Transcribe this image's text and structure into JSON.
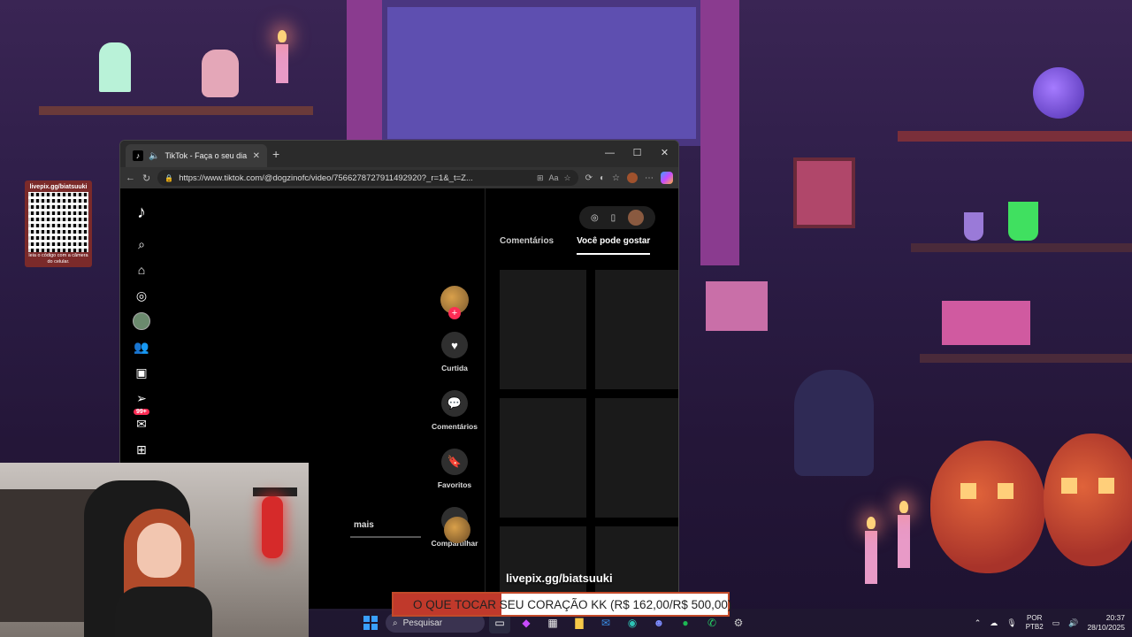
{
  "qr": {
    "top_text": "livepix.gg/biatsuuki",
    "bottom_text": "leia o código com a câmera do celular."
  },
  "browser": {
    "tab_title": "TikTok - Faça o seu dia",
    "new_tab_icon": "plus-icon",
    "url": "https://www.tiktok.com/@dogzinofc/video/7566278727911492920?_r=1&_t=Z...",
    "window_controls": [
      "minimize-icon",
      "maximize-icon",
      "close-icon"
    ]
  },
  "tiktok": {
    "actions": [
      {
        "icon": "heart-icon",
        "label": "Curtida"
      },
      {
        "icon": "comment-icon",
        "label": "Comentários"
      },
      {
        "icon": "bookmark-icon",
        "label": "Favoritos"
      },
      {
        "icon": "share-icon",
        "label": "Compartilhar"
      }
    ],
    "more_label": "mais",
    "inbox_badge": "99+",
    "tabs": [
      {
        "label": "Comentários",
        "active": false
      },
      {
        "label": "Você pode gostar",
        "active": true
      }
    ]
  },
  "overlay": {
    "livepix_text": "livepix.gg/biatsuuki",
    "ticker_text": "O QUE TOCAR SEU CORAÇÃO KK (R$ 162,00/R$ 500,00)"
  },
  "taskbar": {
    "search_placeholder": "Pesquisar",
    "lang_top": "POR",
    "lang_bottom": "PTB2",
    "time": "20:37",
    "date": "28/10/2025"
  },
  "colors": {
    "tiktok_red": "#fe2c55",
    "ticker_red": "#c0392b",
    "windows_blue": "#3aa0ff"
  }
}
